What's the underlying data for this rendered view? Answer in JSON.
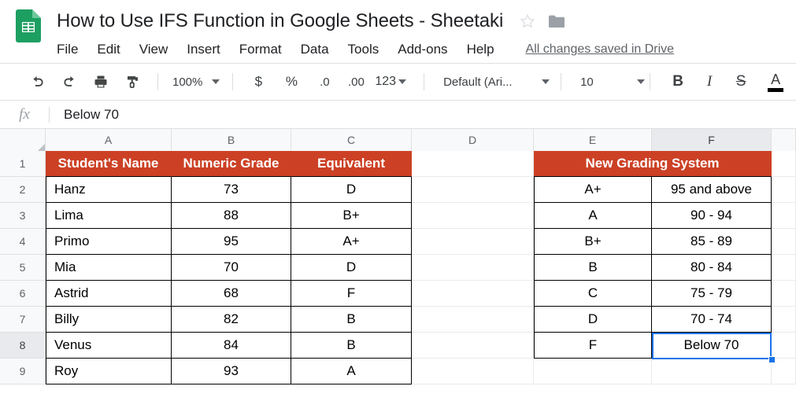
{
  "app": {
    "logo_icon": "google-sheets-logo",
    "doc_title": "How to Use IFS Function in Google Sheets - Sheetaki",
    "star_icon": "star-outline-icon",
    "folder_icon": "folder-icon",
    "brand_green": "#1E9F62",
    "accent_blue": "#1a73e8",
    "header_orange": "#CC4125"
  },
  "menu": {
    "items": [
      "File",
      "Edit",
      "View",
      "Insert",
      "Format",
      "Data",
      "Tools",
      "Add-ons",
      "Help"
    ],
    "save_status": "All changes saved in Drive"
  },
  "toolbar": {
    "undo_icon": "undo-icon",
    "redo_icon": "redo-icon",
    "print_icon": "print-icon",
    "paint_format_icon": "paint-format-icon",
    "zoom_value": "100%",
    "currency_label": "$",
    "percent_label": "%",
    "decrease_decimal_label": ".0",
    "increase_decimal_label": ".00",
    "number_format_label": "123",
    "font_value": "Default (Ari...",
    "font_size_value": "10",
    "bold_label": "B",
    "italic_label": "I",
    "strikethrough_label": "S",
    "text_color_label": "A"
  },
  "formula_bar": {
    "fx_label": "fx",
    "value": "Below 70"
  },
  "grid": {
    "columns": [
      "A",
      "B",
      "C",
      "D",
      "E",
      "F"
    ],
    "active_column": "F",
    "active_row": "8",
    "row_numbers": [
      "1",
      "2",
      "3",
      "4",
      "5",
      "6",
      "7",
      "8",
      "9"
    ],
    "selected_cell": "F8"
  },
  "students_table": {
    "headers": [
      "Student's Name",
      "Numeric Grade",
      "Equivalent"
    ],
    "rows": [
      {
        "name": "Hanz",
        "grade": "73",
        "equivalent": "D"
      },
      {
        "name": "Lima",
        "grade": "88",
        "equivalent": "B+"
      },
      {
        "name": "Primo",
        "grade": "95",
        "equivalent": "A+"
      },
      {
        "name": "Mia",
        "grade": "70",
        "equivalent": "D"
      },
      {
        "name": "Astrid",
        "grade": "68",
        "equivalent": "F"
      },
      {
        "name": "Billy",
        "grade": "82",
        "equivalent": "B"
      },
      {
        "name": "Venus",
        "grade": "84",
        "equivalent": "B"
      },
      {
        "name": "Roy",
        "grade": "93",
        "equivalent": "A"
      }
    ]
  },
  "grading_table": {
    "header": "New Grading System",
    "rows": [
      {
        "grade": "A+",
        "range": "95 and above"
      },
      {
        "grade": "A",
        "range": "90 - 94"
      },
      {
        "grade": "B+",
        "range": "85 - 89"
      },
      {
        "grade": "B",
        "range": "80 - 84"
      },
      {
        "grade": "C",
        "range": "75 - 79"
      },
      {
        "grade": "D",
        "range": "70 - 74"
      },
      {
        "grade": "F",
        "range": "Below 70"
      }
    ]
  }
}
